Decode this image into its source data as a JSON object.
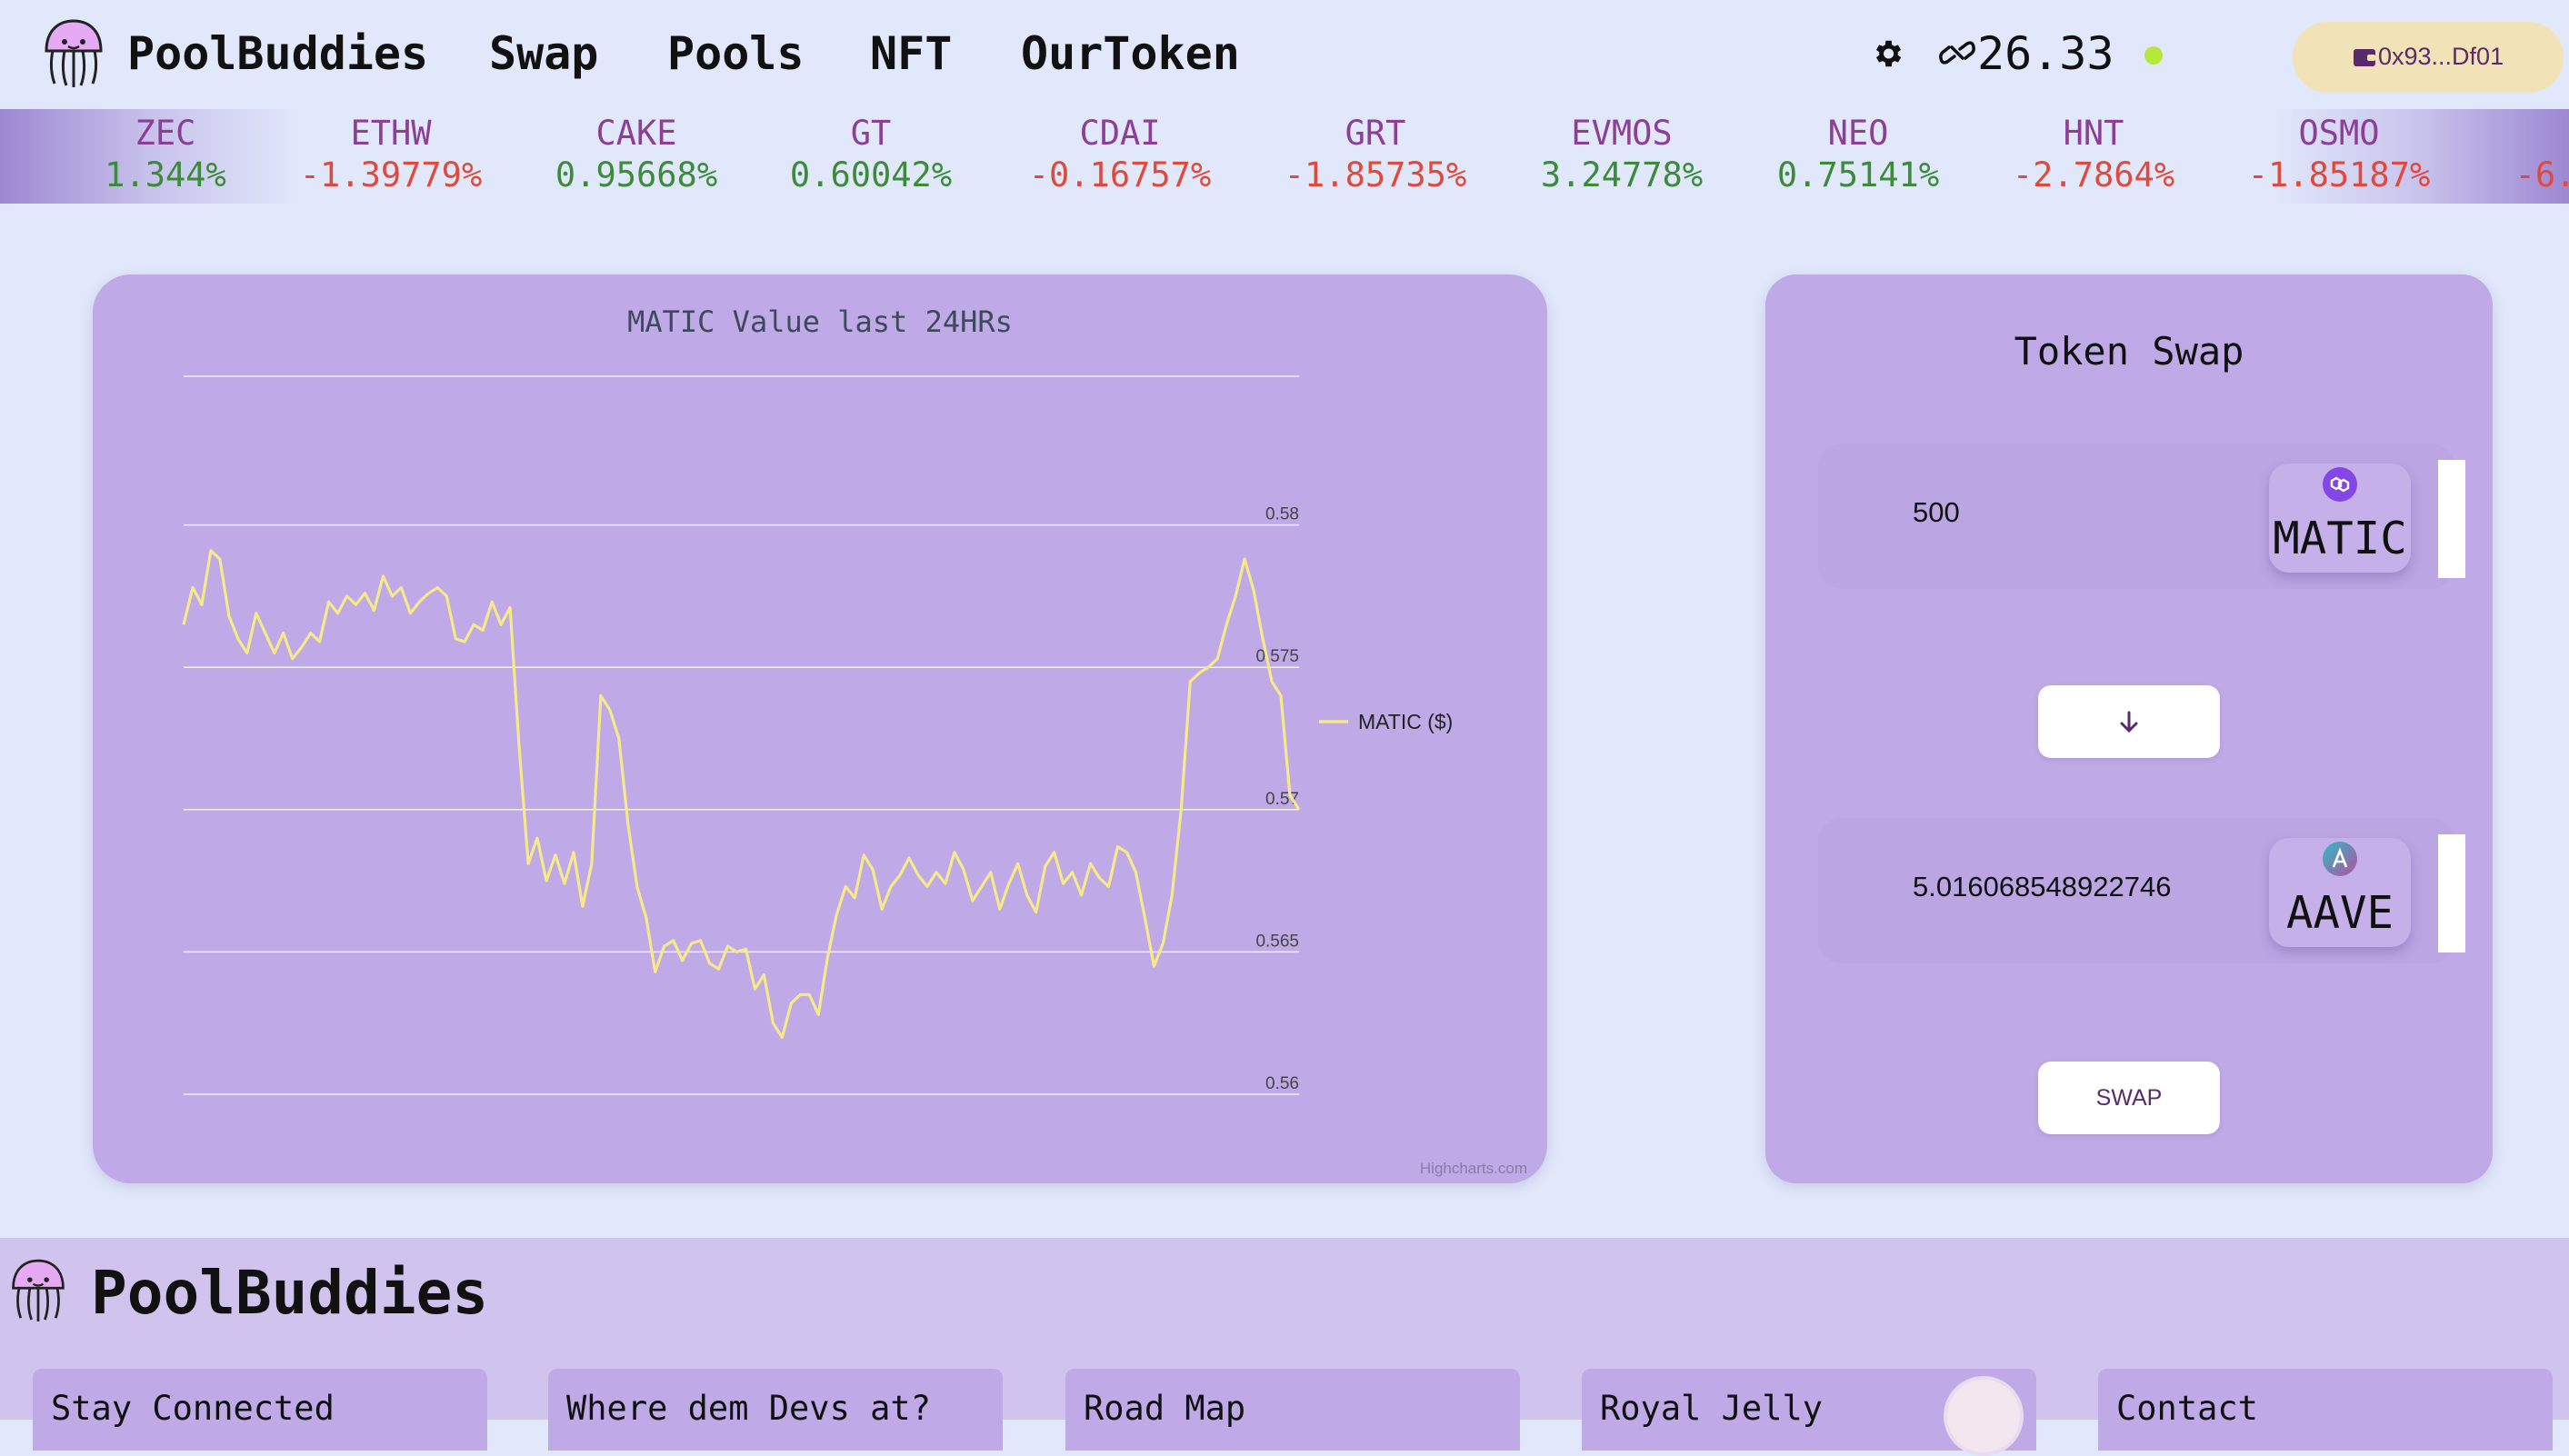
{
  "nav": {
    "brand": "PoolBuddies",
    "links": [
      "Swap",
      "Pools",
      "NFT",
      "OurToken"
    ],
    "gas": "26.33",
    "wallet": "0x93...Df01",
    "icons": [
      "jellyfish-logo-icon",
      "gear-icon",
      "chain-link-icon",
      "wallet-icon"
    ]
  },
  "ticker": [
    {
      "sym": "",
      "chg": "%"
    },
    {
      "sym": "ZEC",
      "chg": "1.344%"
    },
    {
      "sym": "ETHW",
      "chg": "-1.39779%"
    },
    {
      "sym": "CAKE",
      "chg": "0.95668%"
    },
    {
      "sym": "GT",
      "chg": "0.60042%"
    },
    {
      "sym": "CDAI",
      "chg": "-0.16757%"
    },
    {
      "sym": "GRT",
      "chg": "-1.85735%"
    },
    {
      "sym": "EVMOS",
      "chg": "3.24778%"
    },
    {
      "sym": "NEO",
      "chg": "0.75141%"
    },
    {
      "sym": "HNT",
      "chg": "-2.7864%"
    },
    {
      "sym": "OSMO",
      "chg": "-1.85187%"
    },
    {
      "sym": "",
      "chg": "-6."
    }
  ],
  "chart_data": {
    "type": "line",
    "title": "MATIC Value last 24HRs",
    "y_ticks": [
      "0.58",
      "0.575",
      "0.57",
      "0.565",
      "0.56"
    ],
    "ylim": [
      0.5585,
      0.5825
    ],
    "grid": true,
    "legend_position": "right",
    "credits": "Highcharts.com",
    "series": [
      {
        "name": "MATIC ($)",
        "color": "#f5e98a",
        "values": [
          0.5765,
          0.5778,
          0.5772,
          0.5791,
          0.5788,
          0.5768,
          0.576,
          0.5755,
          0.5769,
          0.5762,
          0.5755,
          0.5762,
          0.5753,
          0.5757,
          0.5762,
          0.5759,
          0.5773,
          0.5769,
          0.5775,
          0.5772,
          0.5776,
          0.577,
          0.5782,
          0.5775,
          0.5778,
          0.5769,
          0.5773,
          0.5776,
          0.5778,
          0.5775,
          0.576,
          0.5759,
          0.5765,
          0.5763,
          0.5773,
          0.5765,
          0.5771,
          0.5722,
          0.5681,
          0.569,
          0.5675,
          0.5684,
          0.5674,
          0.5685,
          0.5666,
          0.5681,
          0.574,
          0.5735,
          0.5725,
          0.5695,
          0.5673,
          0.5662,
          0.5643,
          0.5652,
          0.5654,
          0.5647,
          0.5653,
          0.5654,
          0.5646,
          0.5644,
          0.5652,
          0.565,
          0.5651,
          0.5637,
          0.5642,
          0.5625,
          0.562,
          0.5632,
          0.5635,
          0.5635,
          0.5628,
          0.5648,
          0.5663,
          0.5673,
          0.5669,
          0.5684,
          0.5679,
          0.5665,
          0.5673,
          0.5677,
          0.5683,
          0.5677,
          0.5673,
          0.5678,
          0.5674,
          0.5685,
          0.5679,
          0.5668,
          0.5673,
          0.5678,
          0.5665,
          0.5674,
          0.5681,
          0.567,
          0.5664,
          0.568,
          0.5685,
          0.5674,
          0.5678,
          0.567,
          0.5681,
          0.5676,
          0.5673,
          0.5687,
          0.5685,
          0.5678,
          0.5662,
          0.5645,
          0.5653,
          0.567,
          0.57,
          0.5745,
          0.5748,
          0.575,
          0.5753,
          0.5765,
          0.5775,
          0.5788,
          0.5777,
          0.576,
          0.5745,
          0.574,
          0.5705,
          0.57
        ]
      }
    ]
  },
  "swap": {
    "title": "Token Swap",
    "from": {
      "amount": "500",
      "token": "MATIC"
    },
    "to": {
      "amount": "5.016068548922746",
      "token": "AAVE"
    },
    "button": "SWAP"
  },
  "footer": {
    "brand": "PoolBuddies",
    "cards": [
      "Stay Connected",
      "Where dem Devs at?",
      "Road Map",
      "Royal Jelly",
      "Contact"
    ]
  }
}
